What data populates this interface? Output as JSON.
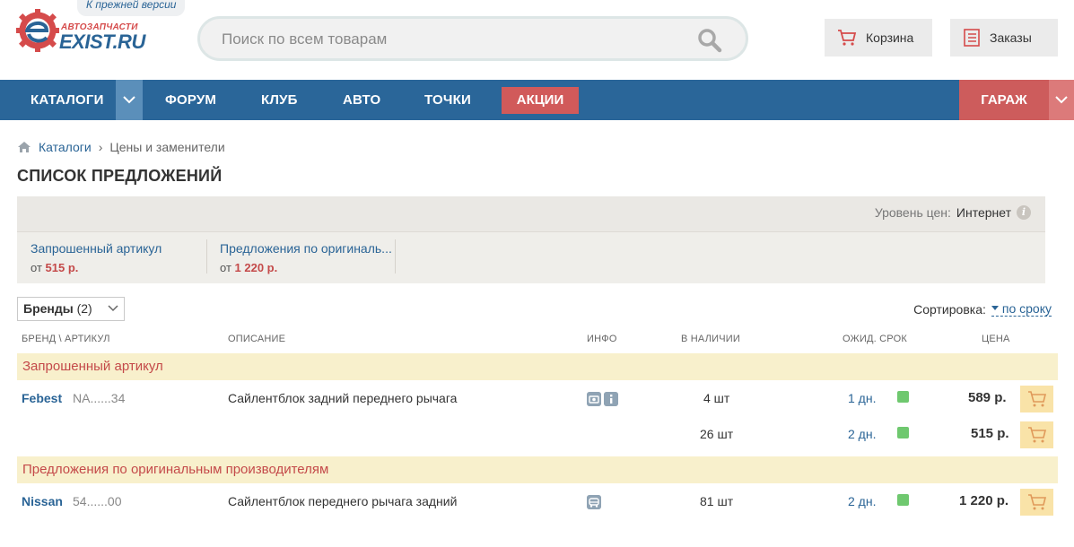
{
  "header": {
    "logo_small": "АВТОЗАПЧАСТИ",
    "logo_main": "EXIST.RU",
    "old_version_link": "К прежней версии",
    "search_placeholder": "Поиск по всем товарам",
    "cart_label": "Корзина",
    "orders_label": "Заказы"
  },
  "nav": {
    "catalogs": "КАТАЛОГИ",
    "forum": "ФОРУМ",
    "club": "КЛУБ",
    "auto": "АВТО",
    "points": "ТОЧКИ",
    "promo": "АКЦИИ",
    "garage": "ГАРАЖ"
  },
  "breadcrumb": {
    "items": [
      "Каталоги",
      "Цены и заменители"
    ]
  },
  "page_title": "СПИСОК ПРЕДЛОЖЕНИЙ",
  "offers": {
    "price_level_label": "Уровень цен:",
    "price_level_value": "Интернет",
    "tabs": [
      {
        "title": "Запрошенный артикул",
        "prefix": "от",
        "price": "515 р."
      },
      {
        "title": "Предложения по оригиналь...",
        "prefix": "от",
        "price": "1 220 р."
      }
    ]
  },
  "toolbar": {
    "brands_label": "Бренды",
    "brands_count": "(2)",
    "sort_label": "Сортировка:",
    "sort_value": "по сроку"
  },
  "table": {
    "headers": {
      "brand": "БРЕНД \\ АРТИКУЛ",
      "description": "ОПИСАНИЕ",
      "info": "ИНФО",
      "stock": "В НАЛИЧИИ",
      "term": "ОЖИД. СРОК",
      "price": "ЦЕНА"
    },
    "groups": [
      {
        "title": "Запрошенный артикул",
        "rows": [
          {
            "brand": "Febest",
            "article": "NA......34",
            "description": "Сайлентблок задний переднего рычага",
            "stock": "4 шт",
            "term": "1 дн.",
            "price": "589 р."
          },
          {
            "brand": "",
            "article": "",
            "description": "",
            "stock": "26 шт",
            "term": "2 дн.",
            "price": "515 р."
          }
        ]
      },
      {
        "title": "Предложения по оригинальным производителям",
        "rows": [
          {
            "brand": "Nissan",
            "article": "54......00",
            "description": "Сайлентблок переднего рычага задний",
            "stock": "81 шт",
            "term": "2 дн.",
            "price": "1 220 р."
          }
        ]
      }
    ]
  },
  "colors": {
    "nav_blue": "#2a6699",
    "promo_red": "#d15a5a",
    "link_blue": "#2a6496",
    "group_bg": "#f8f0cc",
    "cart_btn": "#f9e3a8",
    "stock_green": "#6fc86f"
  },
  "icons": [
    "logo-gear-icon",
    "search-icon",
    "cart-icon",
    "orders-list-icon",
    "chevron-down-icon",
    "home-icon",
    "info-icon",
    "photo-icon",
    "car-icon",
    "add-to-cart-icon"
  ]
}
